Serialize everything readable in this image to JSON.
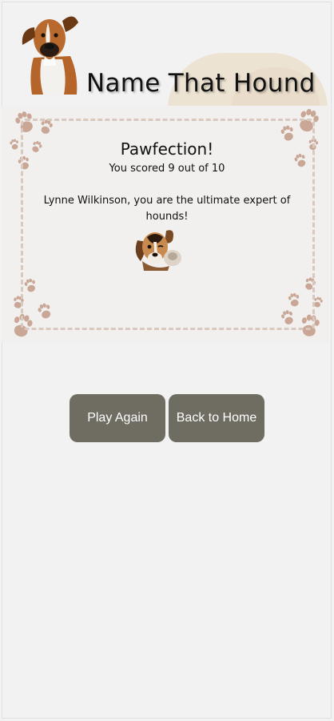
{
  "header": {
    "title": "Name That Hound"
  },
  "result": {
    "heading": "Pawfection!",
    "score_text": "You scored 9 out of 10",
    "message": "Lynne Wilkinson, you are the ultimate expert of hounds!"
  },
  "actions": {
    "play_again_label": "Play Again",
    "back_home_label": "Back to Home"
  },
  "colors": {
    "button": "#6f6c62",
    "paw": "#c9a695",
    "dashed_border": "#d8c8bd",
    "background": "#f2f2f2"
  },
  "icons": {
    "logo": "boxer-dog-image",
    "result": "winking-puppy-image",
    "decoration": "paw-print-icons"
  }
}
